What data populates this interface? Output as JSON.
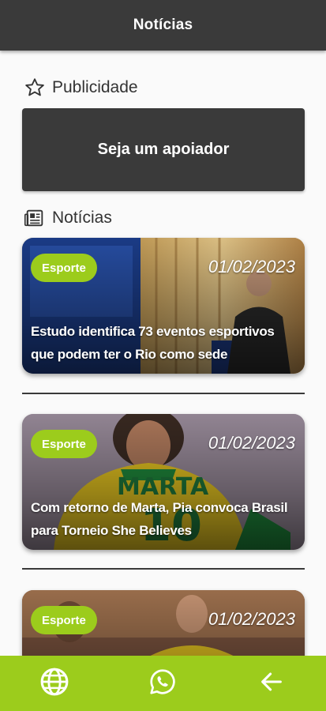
{
  "header": {
    "title": "Notícias"
  },
  "ad_section": {
    "heading": "Publicidade",
    "banner_label": "Seja um apoiador"
  },
  "news_section": {
    "heading": "Notícias",
    "items": [
      {
        "category": "Esporte",
        "date": "01/02/2023",
        "title": "Estudo identifica 73 eventos esportivos que podem ter o Rio como sede"
      },
      {
        "category": "Esporte",
        "date": "01/02/2023",
        "title": "Com retorno de Marta, Pia convoca Brasil para Torneio She Believes"
      },
      {
        "category": "Esporte",
        "date": "01/02/2023",
        "title": ""
      }
    ]
  },
  "bottom_nav": [
    {
      "icon": "globe-icon"
    },
    {
      "icon": "whatsapp-icon"
    },
    {
      "icon": "arrow-back-icon"
    }
  ],
  "colors": {
    "accent": "#9ccc1c",
    "bar": "#3a3a3a"
  }
}
